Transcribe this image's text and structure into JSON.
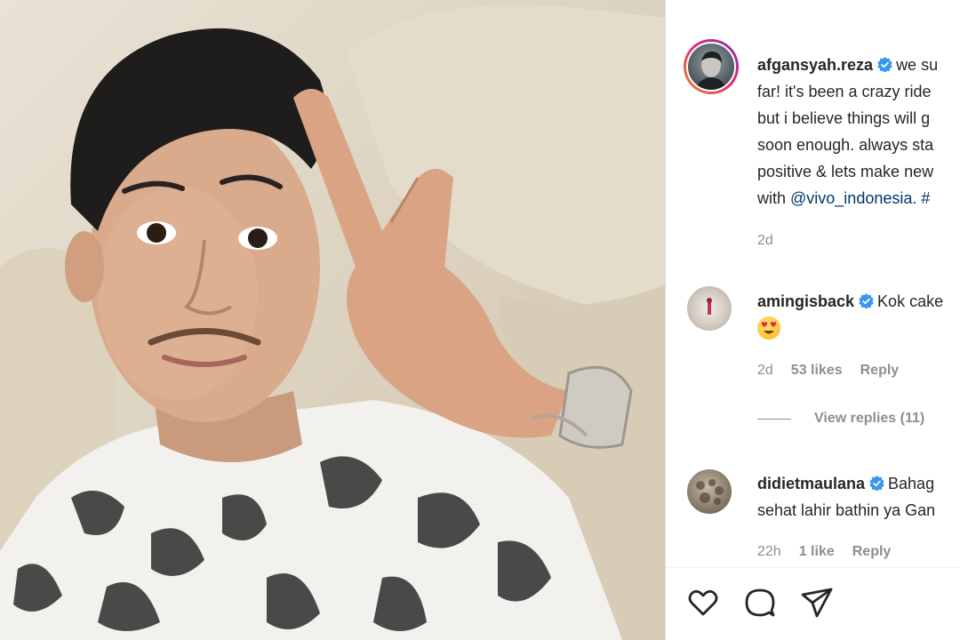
{
  "post": {
    "username": "afgansyah.reza",
    "caption_lines": [
      "we su",
      "far! it's been a crazy ride",
      "but i believe things will g",
      "soon enough. always sta",
      "positive & lets make new",
      "with "
    ],
    "caption_mention": "@vivo_indonesia",
    "caption_tail": ". #",
    "time": "2d"
  },
  "comments": [
    {
      "username": "amingisback",
      "text_line1": "Kok cake",
      "emoji": "heart-eyes",
      "time": "2d",
      "likes": "53 likes",
      "reply_label": "Reply",
      "view_replies": "View replies (11)"
    },
    {
      "username": "didietmaulana",
      "text_line1": "Bahag",
      "text_line2": "sehat lahir bathin ya Gan",
      "time": "22h",
      "likes": "1 like",
      "reply_label": "Reply"
    }
  ],
  "actions": {
    "like_icon": "heart-icon",
    "comment_icon": "comment-icon",
    "share_icon": "share-icon"
  },
  "colors": {
    "verified": "#3897f0",
    "link": "#00376b",
    "muted": "#8e8e8e"
  }
}
